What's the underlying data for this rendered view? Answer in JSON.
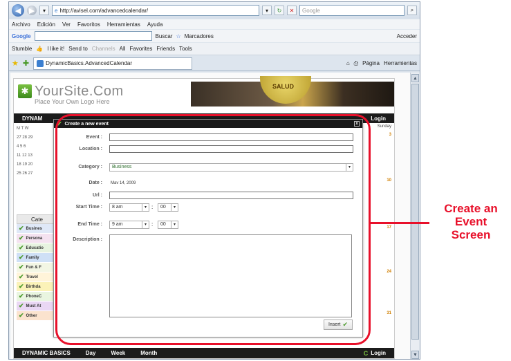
{
  "browser": {
    "url": "http://avisel.com/advancedcalendar/",
    "search_placeholder": "Google",
    "menu": [
      "Archivo",
      "Edición",
      "Ver",
      "Favoritos",
      "Herramientas",
      "Ayuda"
    ],
    "google_label": "Google",
    "google_buttons": [
      "Buscar",
      "Marcadores",
      "Acceder"
    ],
    "stumble_items": [
      "Stumble",
      "I like it!",
      "Send to",
      "Channels",
      "All",
      "Favorites",
      "Friends",
      "Tools"
    ],
    "tab_title": "DynamicBasics.AdvancedCalendar",
    "tab_tools": [
      "Página",
      "Herramientas"
    ]
  },
  "site": {
    "logo_title": "YourSite.Com",
    "logo_subtitle": "Place Your Own Logo Here",
    "banner_text": "SALUD",
    "nav_brand": "DYNAMIC BASICS",
    "nav_brand_short": "DYNAM",
    "nav_items": [
      "Day",
      "Week",
      "Month"
    ],
    "login_label": "Login",
    "calendar_head": "M  T  W",
    "calendar_rows": [
      "27 28 29",
      "4  5  6",
      "11 12 13",
      "18 19 20",
      "25 26 27"
    ],
    "categories_title": "Cate",
    "categories": [
      {
        "label": "Busines",
        "color": "#dfe8f7"
      },
      {
        "label": "Persona",
        "color": "#f4e2f0"
      },
      {
        "label": "Educatio",
        "color": "#e7f3e0"
      },
      {
        "label": "Family",
        "color": "#cfe0f6"
      },
      {
        "label": "Fun & F",
        "color": "#f3f6e4"
      },
      {
        "label": "Travel",
        "color": "#fff4d9"
      },
      {
        "label": "Birthda",
        "color": "#fbf2b8"
      },
      {
        "label": "PhoneC",
        "color": "#e9f5e0"
      },
      {
        "label": "Must At",
        "color": "#ead7f4"
      },
      {
        "label": "Other",
        "color": "#fbe3ce"
      }
    ],
    "right_column": {
      "heading": "Sunday",
      "marks": [
        "3",
        "10",
        "17",
        "24",
        "31"
      ]
    }
  },
  "modal": {
    "title": "Create a new event",
    "close": "x",
    "event_label": "Event :",
    "location_label": "Location :",
    "category_label": "Category :",
    "category_value": "Business",
    "date_label": "Date :",
    "date_value": "Mav 14, 2009",
    "url_label": "Url :",
    "start_label": "Start Time :",
    "start_hour": "8 am",
    "start_min": "00",
    "end_label": "End Time :",
    "end_hour": "9 am",
    "end_min": "00",
    "description_label": "Description :",
    "insert_label": "Insert"
  },
  "annotation": {
    "callout_line1": "Create an",
    "callout_line2": "Event",
    "callout_line3": "Screen",
    "color": "#e8102a"
  }
}
